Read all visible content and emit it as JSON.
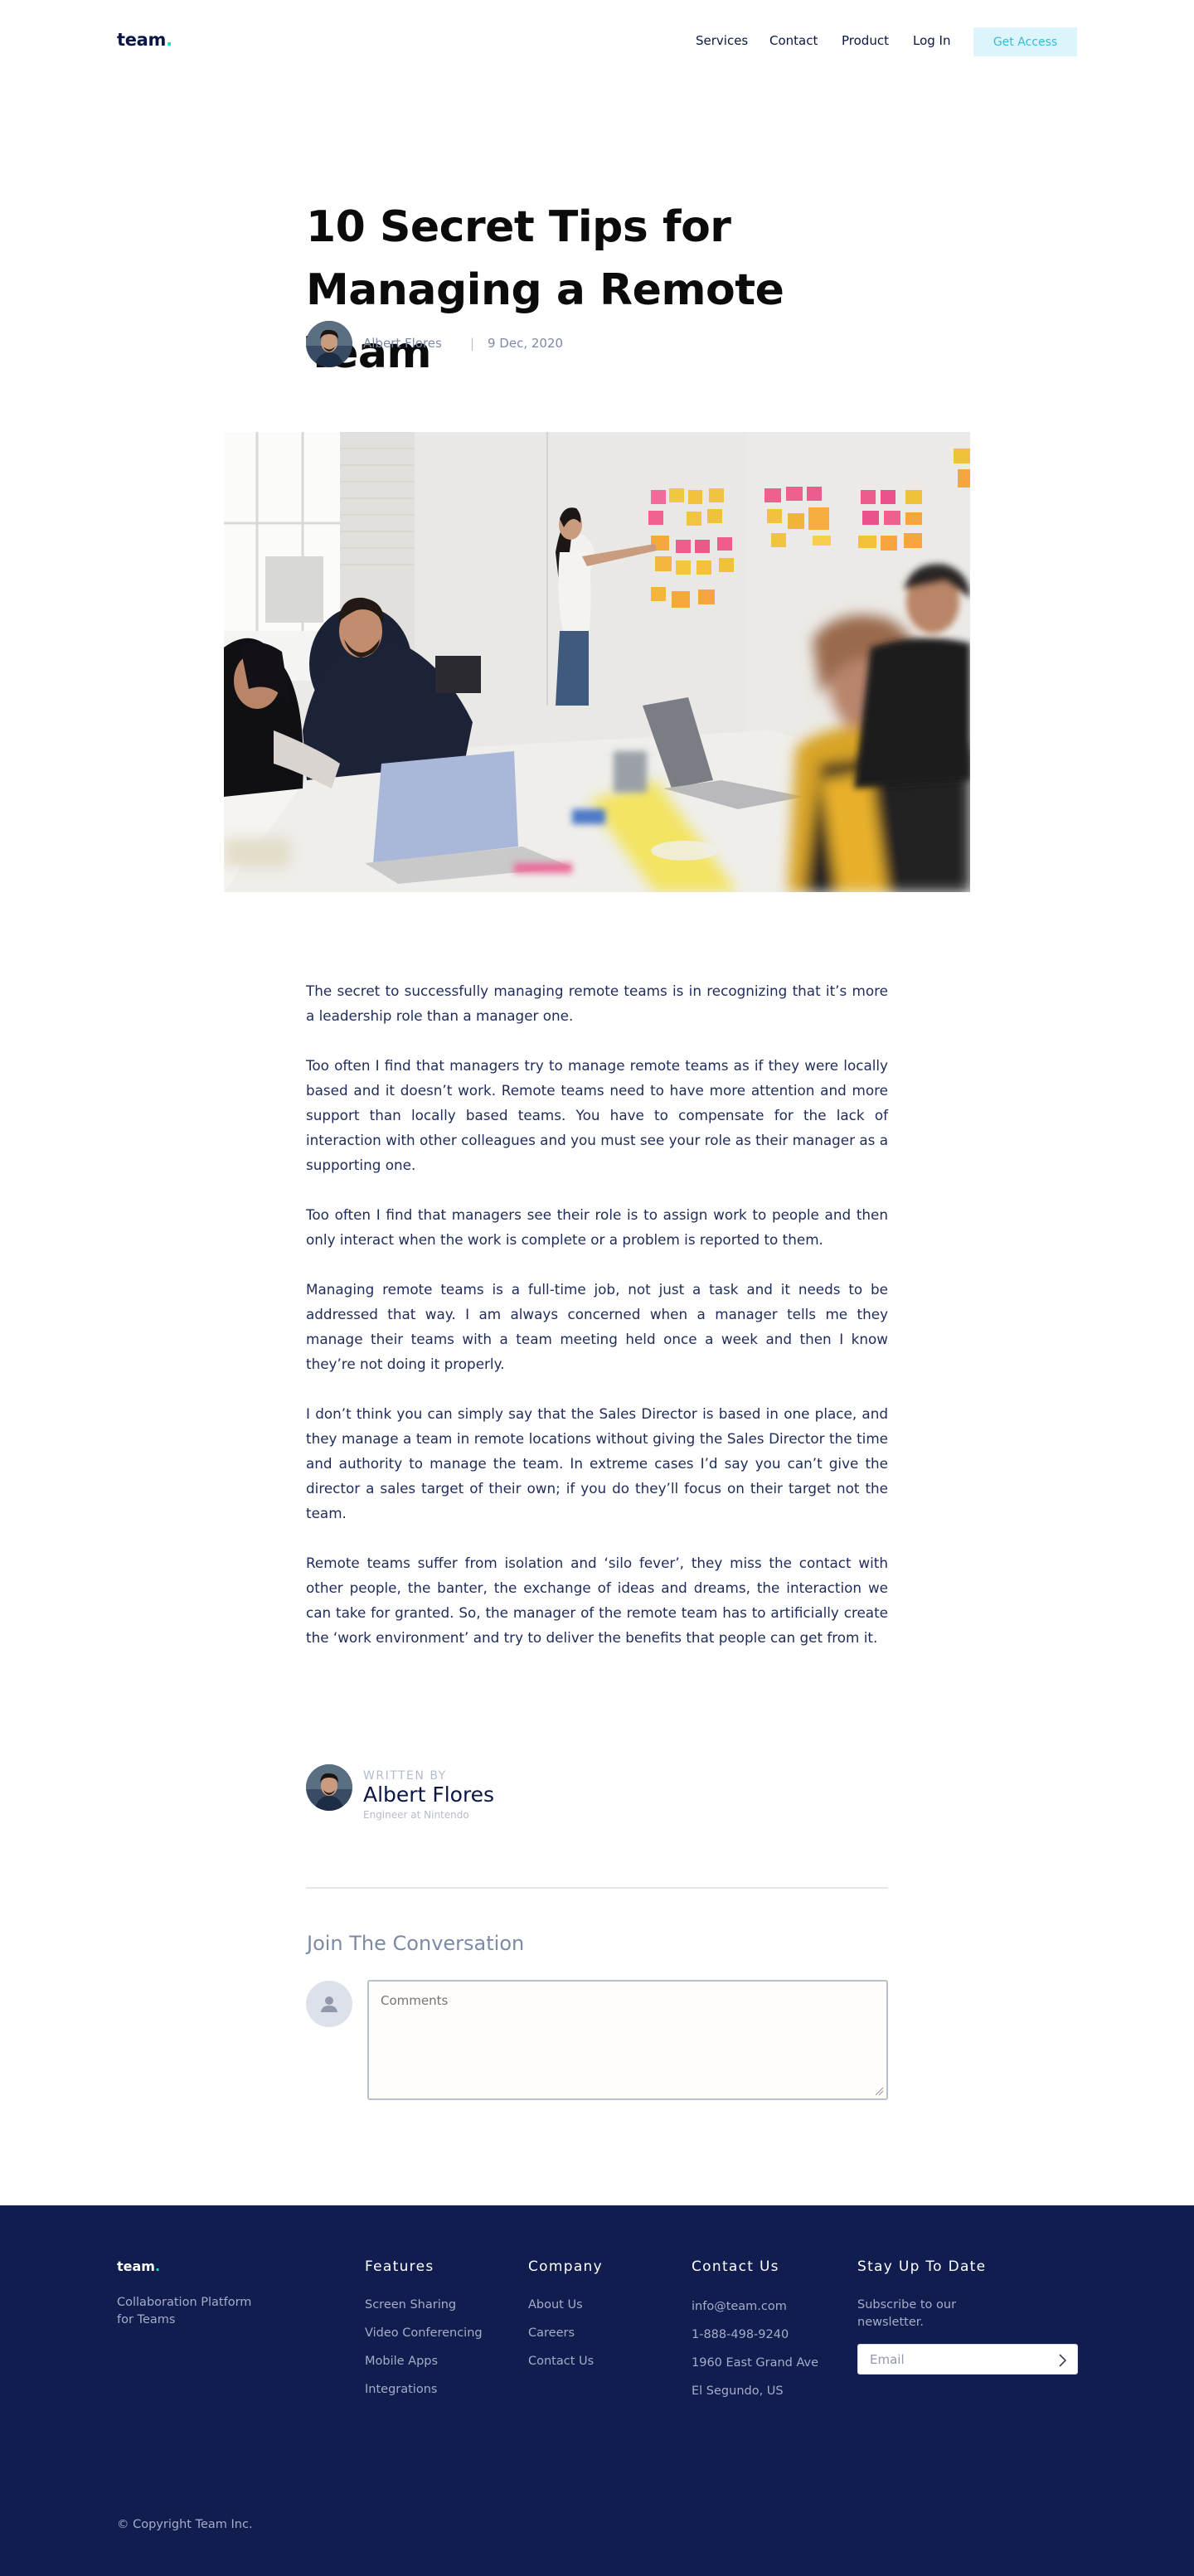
{
  "header": {
    "logo": "team",
    "nav": [
      "Services",
      "Contact",
      "Product",
      "Log In"
    ],
    "cta": "Get Access"
  },
  "article": {
    "title": "10 Secret Tips for Managing a Remote Team",
    "author": "Albert Flores",
    "separator": "|",
    "date": "9 Dec, 2020",
    "paragraphs": [
      "The secret to successfully managing remote teams is in recognizing that it’s more a leadership role than a manager one.",
      "Too often I find that managers try to manage remote teams as if they were locally based and it doesn’t work.  Remote teams need to have more attention and more support than locally based teams.  You have to compensate for the lack of interaction with other colleagues and you must see your role as their manager as a supporting one.",
      "Too often I find that managers see their role is to assign work to people and then only interact when the work is complete or a problem is reported to them.",
      "Managing remote teams is a full-time job, not just a task and it needs to be addressed that way.  I am always concerned when a manager tells me they manage their teams with a team meeting held once a week and then I know they’re not doing it properly.",
      "I don’t think you can simply say that the Sales Director is based in one place, and they manage a team in remote locations without giving the Sales Director the time and authority to manage the team.  In extreme cases I’d say you can’t give the director a sales target of their own; if you do they’ll focus on their target not the team.",
      "Remote teams suffer from isolation and ‘silo fever’, they miss the contact with other people, the banter, the exchange of ideas and dreams, the interaction we can take for granted.  So, the manager of the remote team has to artificially create the ‘work environment’ and try to deliver the benefits that people can get from it."
    ]
  },
  "written_by": {
    "label": "WRITTEN BY",
    "name": "Albert Flores",
    "role": "Engineer at Nintendo"
  },
  "conversation": {
    "title": "Join The Conversation",
    "placeholder": "Comments"
  },
  "footer": {
    "logo": "team",
    "tagline": "Collaboration Platform for Teams",
    "features": {
      "title": "Features",
      "links": [
        "Screen Sharing",
        "Video Conferencing",
        "Mobile Apps",
        "Integrations"
      ]
    },
    "company": {
      "title": "Company",
      "links": [
        "About Us",
        "Careers",
        "Contact Us"
      ]
    },
    "contact": {
      "title": "Contact Us",
      "lines": [
        "info@team.com",
        "1-888-498-9240",
        "1960 East Grand Ave",
        "El Segundo, US"
      ]
    },
    "newsletter": {
      "title": "Stay Up To Date",
      "text": "Subscribe to our newsletter.",
      "placeholder": "Email"
    },
    "copyright": "© Copyright Team Inc."
  },
  "colors": {
    "navy": "#0b1643",
    "footer_bg": "#111c4f",
    "accent_teal": "#25dac5",
    "cta_bg": "#dcf5fc",
    "cta_text": "#3ab9d6"
  }
}
